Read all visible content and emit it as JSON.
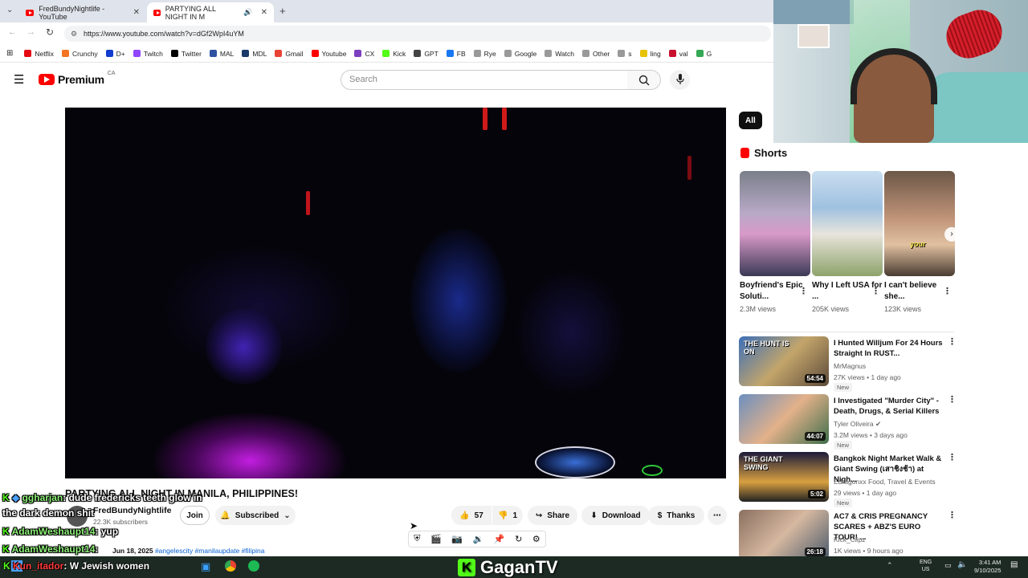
{
  "browser": {
    "tabs": [
      {
        "label": "FredBundyNightlife - YouTube",
        "active": false
      },
      {
        "label": "PARTYING ALL NIGHT IN M",
        "active": true
      }
    ],
    "url": "https://www.youtube.com/watch?v=dGf2WpI4uYM",
    "bookmarks": [
      {
        "label": "Netflix",
        "color": "#e50914"
      },
      {
        "label": "Crunchy",
        "color": "#f47521"
      },
      {
        "label": "D+",
        "color": "#113ccf"
      },
      {
        "label": "Twitch",
        "color": "#9146ff"
      },
      {
        "label": "Twitter",
        "color": "#000000"
      },
      {
        "label": "MAL",
        "color": "#2e51a2"
      },
      {
        "label": "MDL",
        "color": "#1a3a6a"
      },
      {
        "label": "Gmail",
        "color": "#ea4335"
      },
      {
        "label": "Youtube",
        "color": "#ff0000"
      },
      {
        "label": "CX",
        "color": "#7b3fbf"
      },
      {
        "label": "Kick",
        "color": "#53fc18"
      },
      {
        "label": "GPT",
        "color": "#444444"
      },
      {
        "label": "FB",
        "color": "#1877f2"
      },
      {
        "label": "Rye",
        "color": "#999999"
      },
      {
        "label": "Google",
        "color": "#999999"
      },
      {
        "label": "Watch",
        "color": "#999999"
      },
      {
        "label": "Other",
        "color": "#999999"
      },
      {
        "label": "s",
        "color": "#999999"
      },
      {
        "label": "ling",
        "color": "#e6c200"
      },
      {
        "label": "val",
        "color": "#c8102e"
      },
      {
        "label": "G",
        "color": "#34a853"
      }
    ]
  },
  "youtube": {
    "logo": "Premium",
    "region": "CA",
    "search_placeholder": "Search",
    "video": {
      "title": "PARTYING ALL NIGHT IN MANILA, PHILIPPINES!",
      "channel": "FredBundyNightlife",
      "subscribers": "22.3K subscribers",
      "join": "Join",
      "subscribed": "Subscribed",
      "likes": "57",
      "dislikes": "1",
      "share": "Share",
      "download": "Download",
      "thanks": "Thanks",
      "description_start": "Jun 18, 2025",
      "hashtags": "#angelescity #manilaupdate #filipina"
    },
    "chips": [
      "All"
    ],
    "shorts_heading": "Shorts",
    "shorts": [
      {
        "title": "Boyfriend's Epic Soluti...",
        "views": "2.3M views"
      },
      {
        "title": "Why I Left USA for ...",
        "views": "205K views"
      },
      {
        "title": "I can't believe she...",
        "views": "123K views",
        "overlay": "your"
      }
    ],
    "recommendations": [
      {
        "title": "I Hunted Willjum For 24 Hours Straight In RUST...",
        "channel": "MrMagnus",
        "meta": "27K views • 1 day ago",
        "badge": "New",
        "duration": "54:54",
        "thumb_text": "THE HUNT IS ON"
      },
      {
        "title": "I Investigated \"Murder City\" - Death, Drugs, & Serial Killers",
        "channel": "Tyler Oliveira",
        "meta": "3.2M views • 3 days ago",
        "badge": "New",
        "duration": "44:07",
        "verified": true
      },
      {
        "title": "Bangkok Night Market Walk & Giant Swing (เสาชิงช้า) at Nigh...",
        "channel": "Edragonxx Food, Travel & Events",
        "meta": "29 views • 1 day ago",
        "badge": "New",
        "duration": "5:02",
        "thumb_text": "THE GIANT SWING"
      },
      {
        "title": "AC7 & CRIS PREGNANCY SCARES + ABZ'S EURO TOUR! ...",
        "channel": "Kick_Clipz",
        "meta": "1K views • 9 hours ago",
        "duration": "26:18"
      }
    ]
  },
  "chat": [
    {
      "user": "ggharjan",
      "message": ": dude fredericks teeth glow in"
    },
    {
      "user": "",
      "message": "the dark demon shit"
    },
    {
      "user": "AdamWeshaupt14",
      "message": ": yup"
    },
    {
      "user": "AdamWeshaupt14",
      "message": ":"
    }
  ],
  "taskbar": {
    "left_label": "Kun_itador",
    "left_message": ": W Jewish women",
    "stream_name": "GaganTV",
    "lang": "ENG",
    "region": "US",
    "time": "3:41 AM",
    "date": "9/10/2025"
  },
  "colors": {
    "yt_red": "#ff0000",
    "kick_green": "#53fc18",
    "chat_user": "#8ff27a"
  }
}
